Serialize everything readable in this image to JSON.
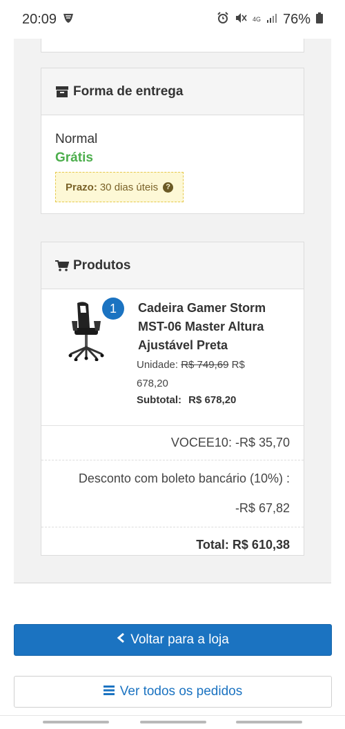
{
  "status": {
    "time": "20:09",
    "battery": "76%",
    "network": "4G"
  },
  "delivery": {
    "title": "Forma de entrega",
    "method": "Normal",
    "price": "Grátis",
    "deadline_label": "Prazo:",
    "deadline_value": "30 dias úteis"
  },
  "products": {
    "title": "Produtos",
    "items": [
      {
        "quantity": "1",
        "name": "Cadeira Gamer Storm MST-06 Master Altura Ajustável Preta",
        "unit_label": "Unidade:",
        "old_price": "R$ 749,69",
        "price": "R$ 678,20",
        "subtotal_label": "Subtotal:",
        "subtotal": "R$ 678,20"
      }
    ],
    "coupon": "VOCEE10: -R$ 35,70",
    "discount_label": "Desconto com boleto bancário (10%) :",
    "discount_value": "-R$ 67,82",
    "total": "Total: R$ 610,38"
  },
  "actions": {
    "back_label": "Voltar para a loja",
    "orders_label": "Ver todos os pedidos"
  },
  "colors": {
    "accent": "#1b73c1",
    "success": "#4cae4c",
    "notice_bg": "#fdf8d6"
  }
}
